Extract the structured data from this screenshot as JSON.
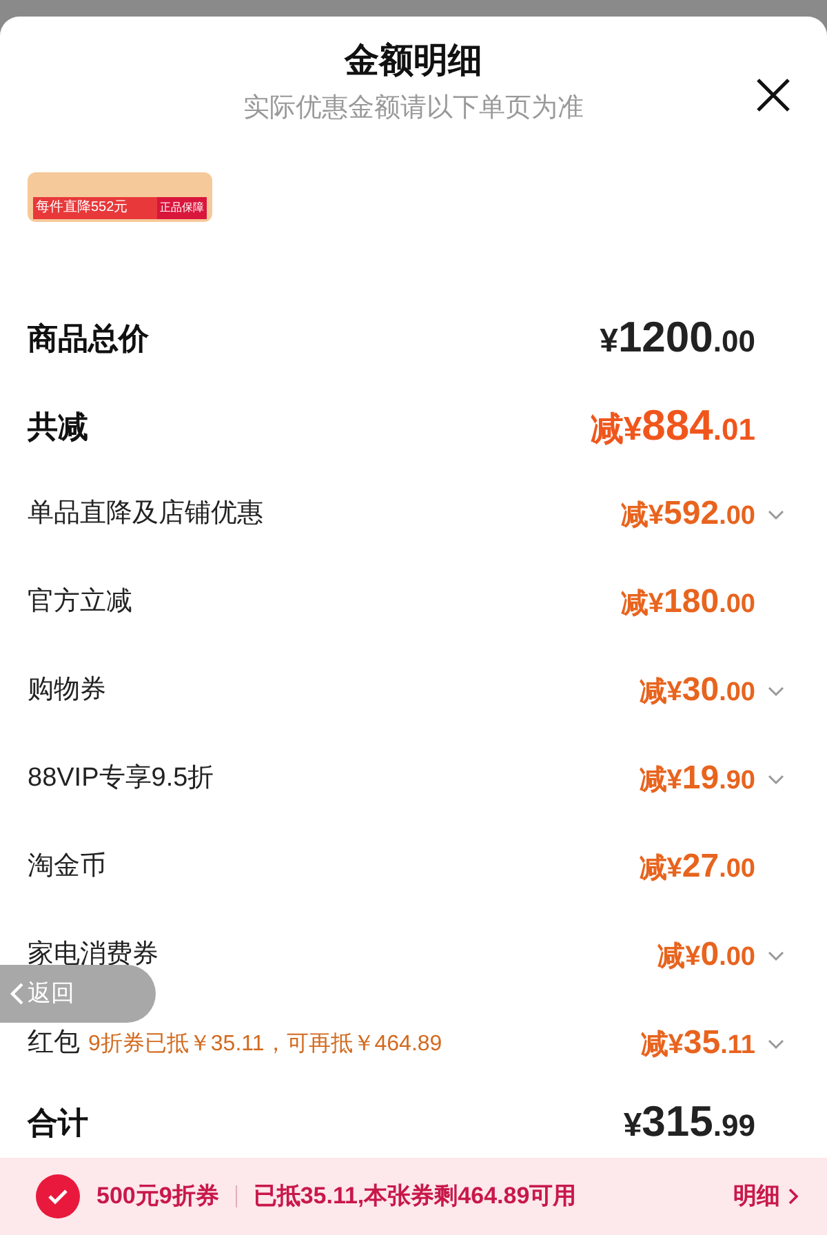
{
  "sheet": {
    "title": "金额明细",
    "subtitle": "实际优惠金额请以下单页为准",
    "banner": {
      "text": "每件直降552元",
      "tag": "正品保障"
    }
  },
  "rows": [
    {
      "kind": "total",
      "label": "商品总价",
      "prefix": "¥",
      "integer": "1200",
      "decimal": ".00",
      "expandable": false
    },
    {
      "kind": "discount_total",
      "label": "共减",
      "prefix": "减¥",
      "integer": "884",
      "decimal": ".01",
      "expandable": false
    },
    {
      "kind": "discount",
      "label": "单品直降及店铺优惠",
      "prefix": "减¥",
      "integer": "592",
      "decimal": ".00",
      "expandable": true
    },
    {
      "kind": "discount",
      "label": "官方立减",
      "prefix": "减¥",
      "integer": "180",
      "decimal": ".00",
      "expandable": false
    },
    {
      "kind": "discount",
      "label": "购物券",
      "prefix": "减¥",
      "integer": "30",
      "decimal": ".00",
      "expandable": true
    },
    {
      "kind": "discount",
      "label": "88VIP专享9.5折",
      "prefix": "减¥",
      "integer": "19",
      "decimal": ".90",
      "expandable": true
    },
    {
      "kind": "discount",
      "label": "淘金币",
      "prefix": "减¥",
      "integer": "27",
      "decimal": ".00",
      "expandable": false
    },
    {
      "kind": "discount",
      "label": "家电消费券",
      "prefix": "减¥",
      "integer": "0",
      "decimal": ".00",
      "expandable": true
    },
    {
      "kind": "discount",
      "label": "红包",
      "note": "9折券已抵￥35.11，可再抵￥464.89",
      "prefix": "减¥",
      "integer": "35",
      "decimal": ".11",
      "expandable": true
    },
    {
      "kind": "total",
      "label": "合计",
      "prefix": "¥",
      "integer": "315",
      "decimal": ".99",
      "expandable": false
    }
  ],
  "back_button": {
    "label": "返回"
  },
  "coupon_bar": {
    "checked": true,
    "name": "500元9折券",
    "info": "已抵35.11,本张券剩464.89可用",
    "link": "明细"
  }
}
